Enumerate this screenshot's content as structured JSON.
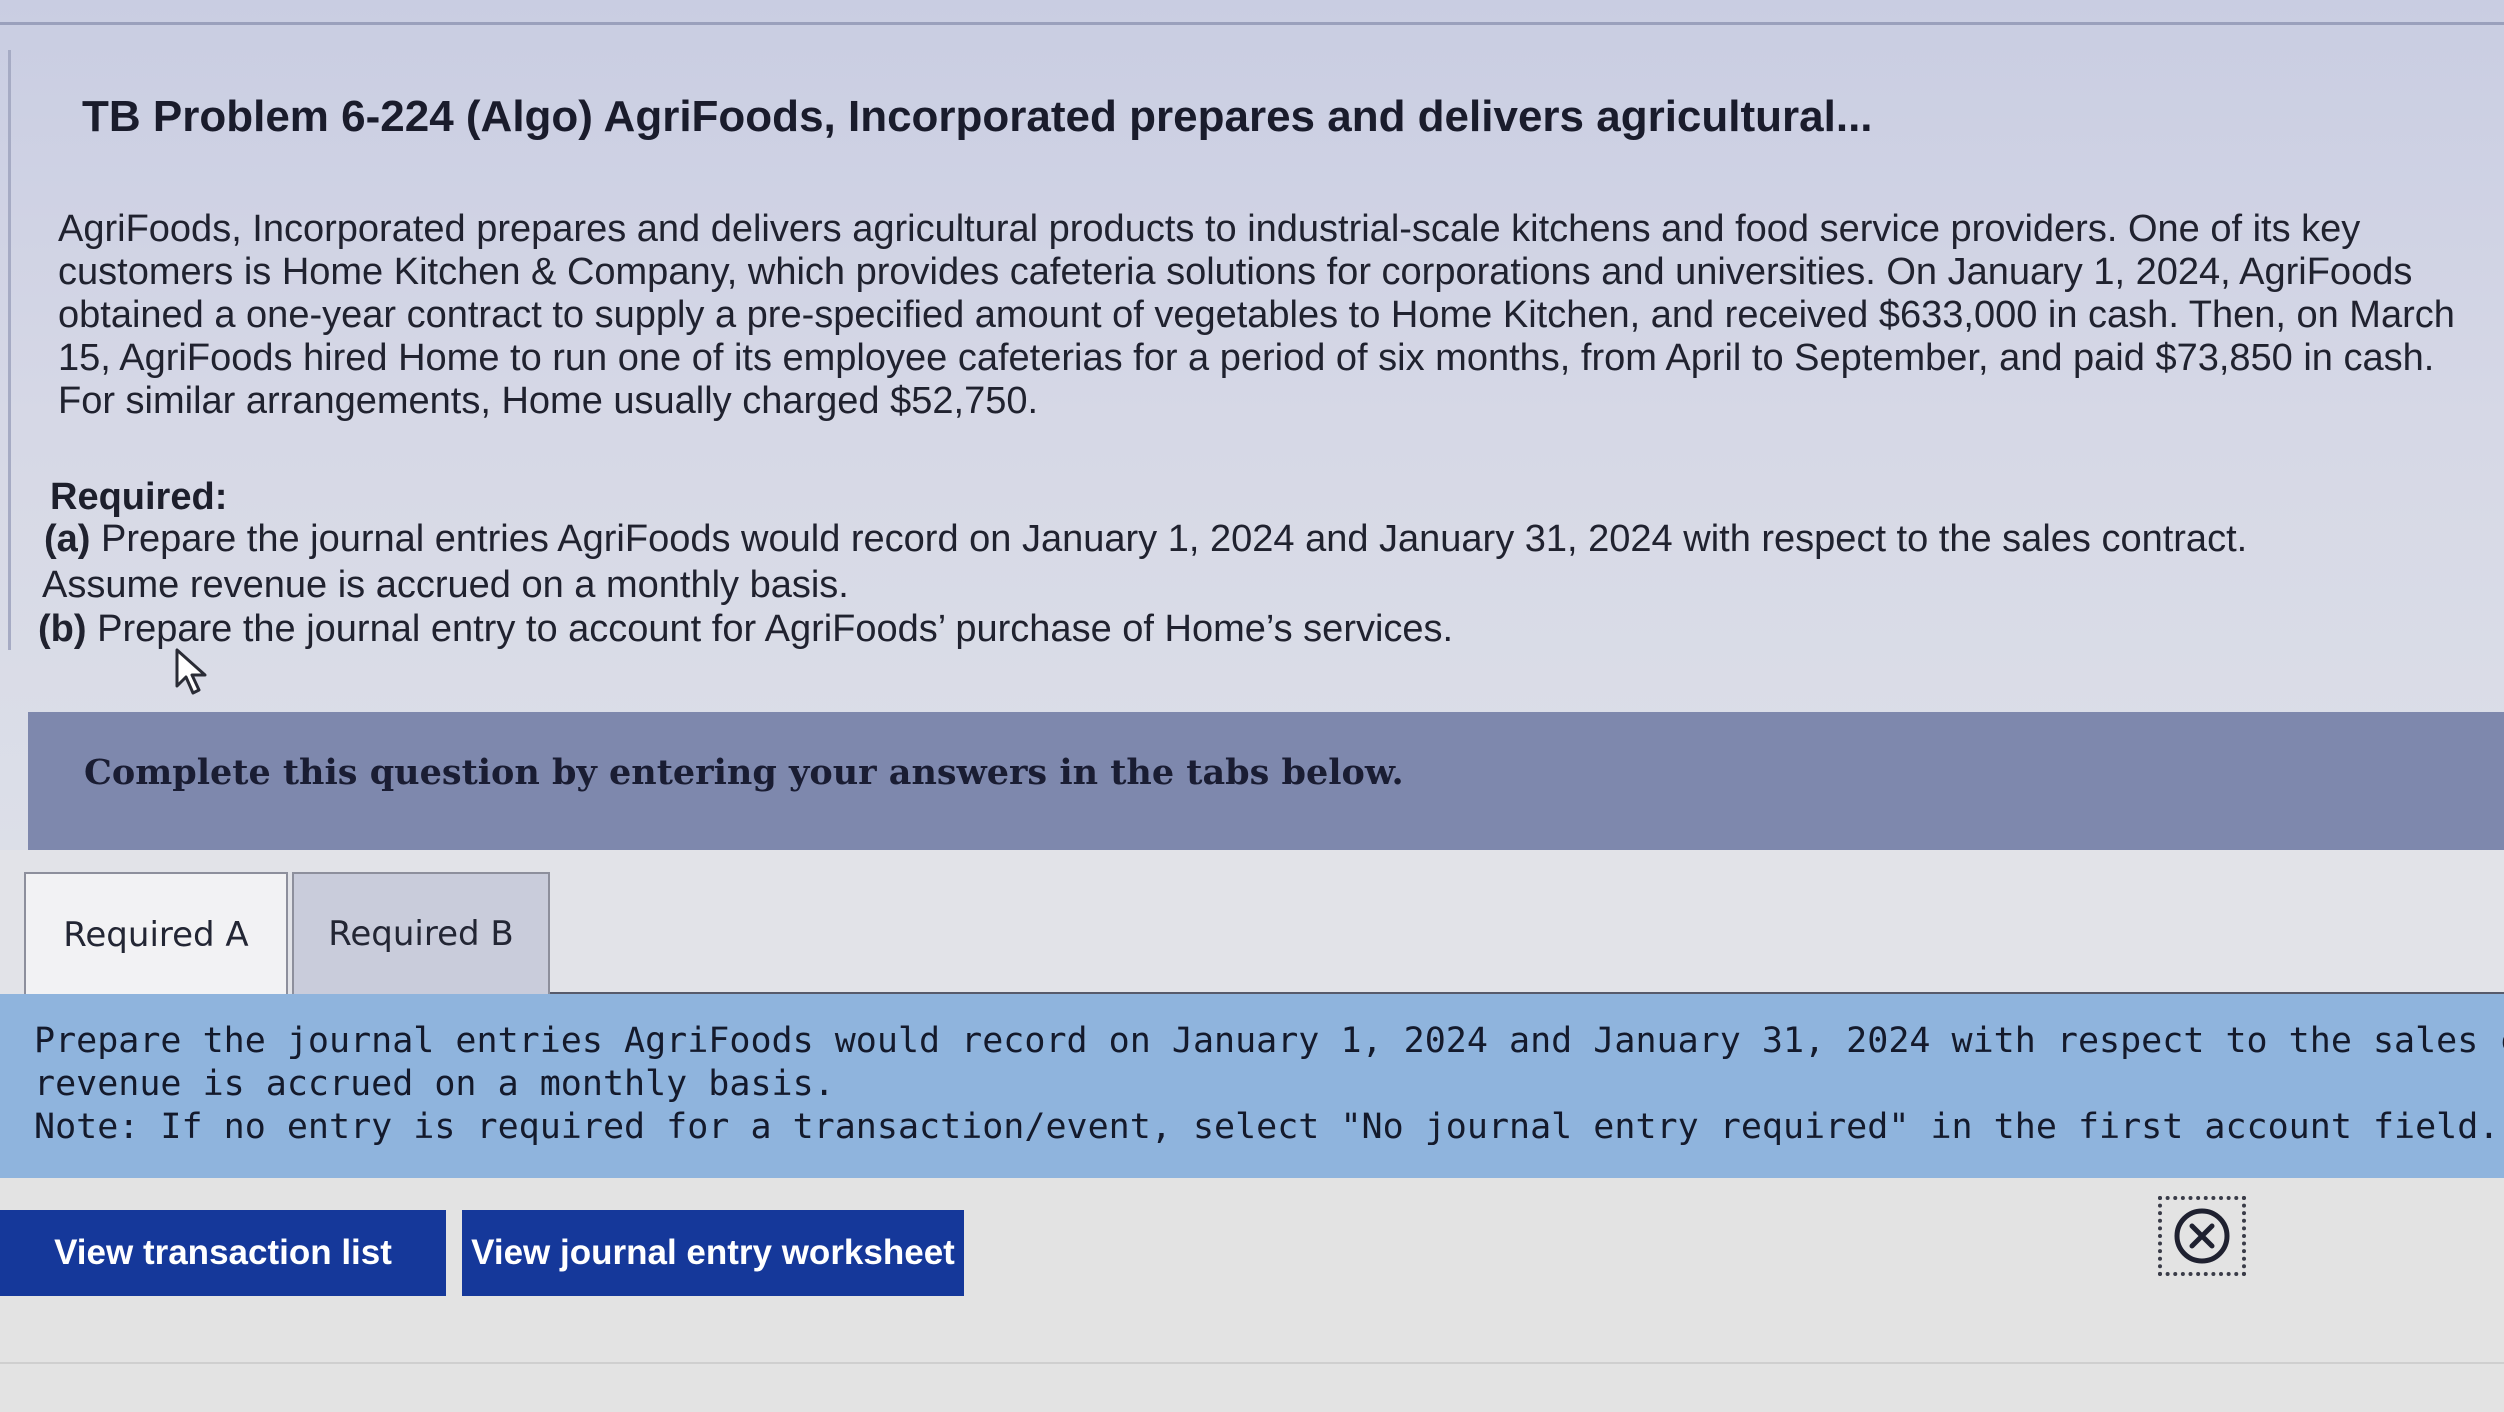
{
  "title": "TB Problem 6-224 (Algo) AgriFoods, Incorporated prepares and delivers agricultural...",
  "problem_text": "AgriFoods, Incorporated prepares and delivers agricultural products to industrial-scale kitchens and food service providers. One of its key customers is Home Kitchen & Company, which provides cafeteria solutions for corporations and universities. On January 1, 2024, AgriFoods obtained a one-year contract to supply a pre-specified amount of vegetables to Home Kitchen, and received $633,000 in cash. Then, on March 15, AgriFoods hired Home to run one of its employee cafeterias for a period of six months, from April to September, and paid $73,850 in cash. For similar arrangements, Home usually charged $52,750.",
  "required": {
    "heading": "Required:",
    "a_label": "(a)",
    "a_text": "Prepare the journal entries AgriFoods would record on January 1, 2024 and January 31, 2024 with respect to the sales contract.",
    "a_text_cont": "Assume revenue is accrued on a monthly basis.",
    "b_label": "(b)",
    "b_text": "Prepare the journal entry to account for AgriFoods’ purchase of Home’s services."
  },
  "banner": "Complete this question by entering your answers in the tabs below.",
  "tabs": [
    {
      "label": "Required A"
    },
    {
      "label": "Required B"
    }
  ],
  "instructions": {
    "line1": "Prepare the journal entries AgriFoods would record on January 1, 2024 and January 31, 2024 with respect to the sales contract. Assum",
    "line2": "revenue is accrued on a monthly basis.",
    "note": "Note: If no entry is required for a transaction/event, select \"No journal entry required\" in the first account field."
  },
  "buttons": {
    "transaction_list": "View transaction list",
    "journal_worksheet": "View journal entry worksheet"
  },
  "colors": {
    "banner": "#7e88ad",
    "instructions_bg": "#8fb4dd",
    "button_bg": "#15389a"
  }
}
